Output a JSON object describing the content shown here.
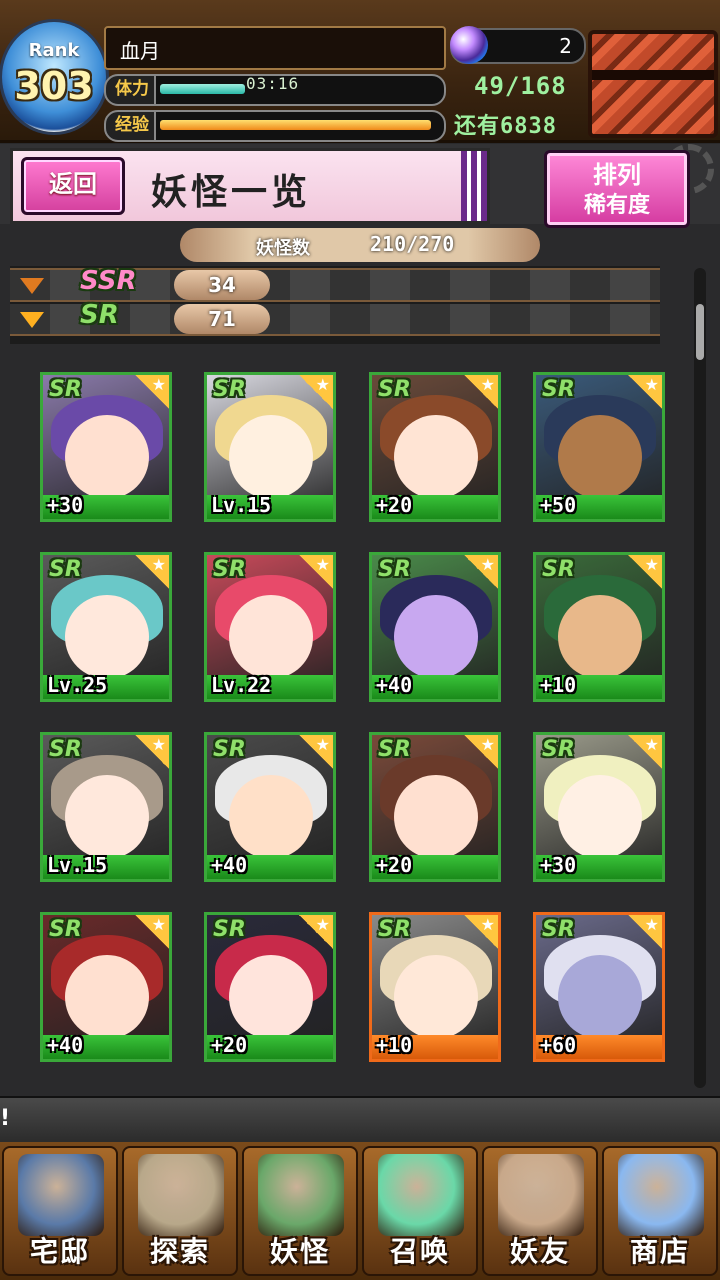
{
  "status": {
    "rank_label": "Rank",
    "rank": "303",
    "player_name": "血月",
    "stamina_label": "体力",
    "stamina_timer": "03:16",
    "stamina_fill": 0.3,
    "exp_label": "经验",
    "exp_fill": 0.96,
    "gems": "2",
    "stamina_value": "49/168",
    "exp_remaining": "还有6838"
  },
  "header": {
    "back_label": "返回",
    "title": "妖怪一览",
    "sort_label": "排列",
    "sort_value": "稀有度"
  },
  "count": {
    "label": "妖怪数",
    "value": "210/270"
  },
  "rarity_filter": [
    {
      "badge": "SSR",
      "count": "34"
    },
    {
      "badge": "SR",
      "count": "71"
    }
  ],
  "cards": [
    {
      "rarity": "SR",
      "label": "+30",
      "frame": "sr",
      "hair": "#6a4aa8",
      "skin": "#ffe0d0",
      "bg": "#8a7aaa"
    },
    {
      "rarity": "SR",
      "label": "Lv.15",
      "frame": "sr",
      "hair": "#f0d890",
      "skin": "#fff0e0",
      "bg": "#d8d8e0"
    },
    {
      "rarity": "SR",
      "label": "+20",
      "frame": "sr",
      "hair": "#8a4a2a",
      "skin": "#ffe4d4",
      "bg": "#6a4a3a"
    },
    {
      "rarity": "SR",
      "label": "+50",
      "frame": "sr",
      "hair": "#2a3a5a",
      "skin": "#b07a4a",
      "bg": "#3a5a7a"
    },
    {
      "rarity": "SR",
      "label": "Lv.25",
      "frame": "sr",
      "hair": "#6ac8c8",
      "skin": "#ffe8dc",
      "bg": "#5a5a5a"
    },
    {
      "rarity": "SR",
      "label": "Lv.22",
      "frame": "sr",
      "hair": "#e84a6a",
      "skin": "#ffe4d8",
      "bg": "#c84a5a"
    },
    {
      "rarity": "SR",
      "label": "+40",
      "frame": "sr",
      "hair": "#2a2a5a",
      "skin": "#c8a8f0",
      "bg": "#4a8a4a"
    },
    {
      "rarity": "SR",
      "label": "+10",
      "frame": "sr",
      "hair": "#2a6a3a",
      "skin": "#e8b88a",
      "bg": "#3a6a3a"
    },
    {
      "rarity": "SR",
      "label": "Lv.15",
      "frame": "sr",
      "hair": "#a89a8a",
      "skin": "#ffe8dc",
      "bg": "#5a5a5a"
    },
    {
      "rarity": "SR",
      "label": "+40",
      "frame": "sr",
      "hair": "#e8e8e8",
      "skin": "#ffe0c8",
      "bg": "#4a4a4a"
    },
    {
      "rarity": "SR",
      "label": "+20",
      "frame": "sr",
      "hair": "#6a3a2a",
      "skin": "#ffe0d0",
      "bg": "#7a4a3a"
    },
    {
      "rarity": "SR",
      "label": "+30",
      "frame": "sr",
      "hair": "#f0f0c0",
      "skin": "#fff0e4",
      "bg": "#9a9a8a"
    },
    {
      "rarity": "SR",
      "label": "+40",
      "frame": "sr",
      "hair": "#a82a2a",
      "skin": "#ffe0d0",
      "bg": "#6a2a2a"
    },
    {
      "rarity": "SR",
      "label": "+20",
      "frame": "sr",
      "hair": "#c82a4a",
      "skin": "#ffe4dc",
      "bg": "#2a2a3a"
    },
    {
      "rarity": "SR",
      "label": "+10",
      "frame": "ur",
      "hair": "#e8d8b8",
      "skin": "#ffe8d8",
      "bg": "#8a8a8a"
    },
    {
      "rarity": "SR",
      "label": "+60",
      "frame": "ur",
      "hair": "#e0e0f0",
      "skin": "#a8a8d8",
      "bg": "#6a6a8a"
    }
  ],
  "notice": "!",
  "nav": [
    {
      "label": "宅邸",
      "icon": "mansion-icon",
      "color": "#5a7aa8"
    },
    {
      "label": "探索",
      "icon": "magnifier-icon",
      "color": "#b8a88a"
    },
    {
      "label": "妖怪",
      "icon": "scroll-icon",
      "color": "#6aa86a"
    },
    {
      "label": "召唤",
      "icon": "pentagram-icon",
      "color": "#6ad8a8"
    },
    {
      "label": "妖友",
      "icon": "catgirl-icon",
      "color": "#c8a88a"
    },
    {
      "label": "商店",
      "icon": "crystal-ball-icon",
      "color": "#8ab8f0"
    }
  ]
}
